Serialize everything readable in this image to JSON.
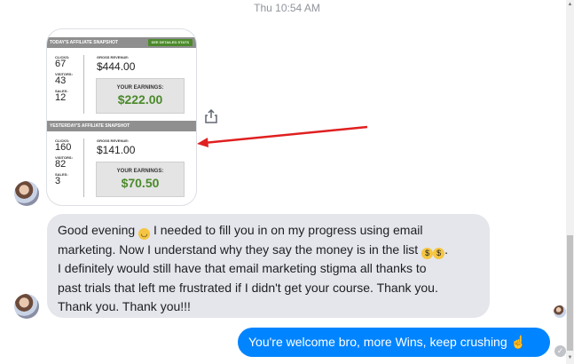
{
  "timestamp": "Thu 10:54 AM",
  "snapshot": {
    "today": {
      "title": "TODAY'S AFFILIATE SNAPSHOT",
      "button": "SEE DETAILED STATS",
      "clicks_label": "CLICKS:",
      "clicks": "67",
      "visitors_label": "VISITORS:",
      "visitors": "43",
      "sales_label": "SALES:",
      "sales": "12",
      "gross_label": "GROSS REVENUE:",
      "gross": "$444.00",
      "earnings_label": "YOUR EARNINGS:",
      "earnings": "$222.00"
    },
    "yesterday": {
      "title": "YESTERDAY'S AFFILIATE SNAPSHOT",
      "clicks_label": "CLICKS:",
      "clicks": "160",
      "visitors_label": "VISITORS:",
      "visitors": "82",
      "sales_label": "SALES:",
      "sales": "3",
      "gross_label": "GROSS REVENUE:",
      "gross": "$141.00",
      "earnings_label": "YOUR EARNINGS:",
      "earnings": "$70.50"
    }
  },
  "messages": {
    "received_line1": "Good evening ",
    "received_line1b": " I needed to fill you in on my progress using email",
    "received_line2": "marketing. Now I understand why they say the money is in the list ",
    "received_line3": "I definitely would still have that email marketing stigma all thanks to",
    "received_line4": "past trials that left me frustrated if I didn't get your course. Thank you.",
    "received_line5": "Thank you. Thank you!!!",
    "sent": "You're welcome bro, more Wins, keep crushing "
  },
  "colors": {
    "sent_bubble": "#0084ff",
    "received_bubble": "#e4e6eb",
    "earnings_green": "#4b8a2b",
    "arrow_red": "#e02020"
  },
  "icons": {
    "share": "share-icon",
    "seen": "check-icon"
  }
}
